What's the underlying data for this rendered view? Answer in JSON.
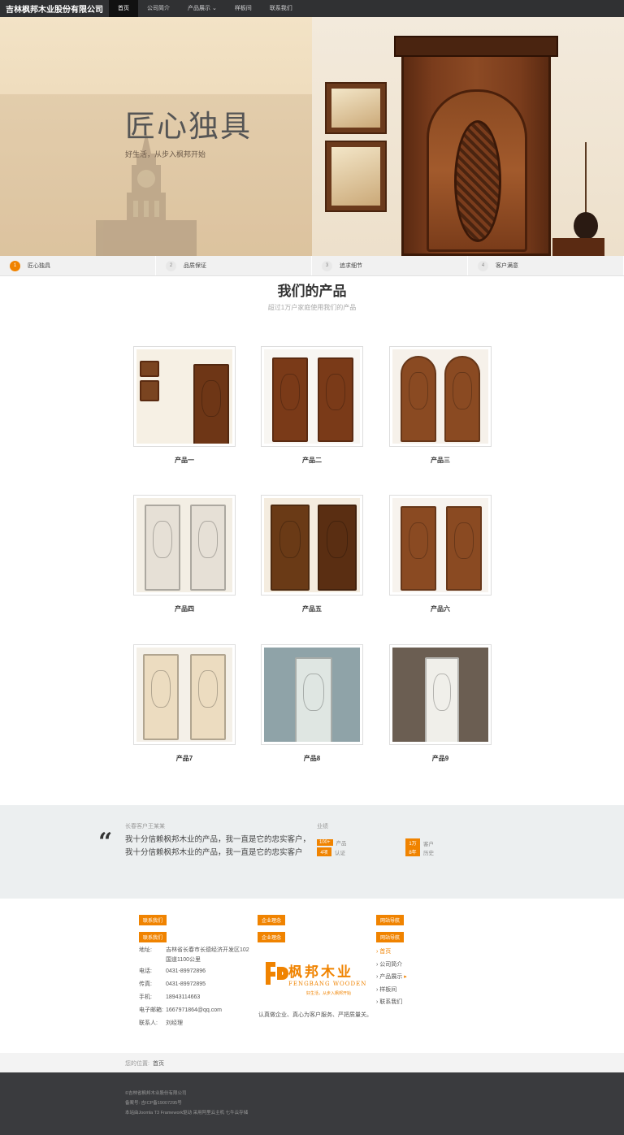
{
  "nav": {
    "brand": "吉林枫邦木业股份有限公司",
    "items": [
      {
        "label": "首页",
        "active": true
      },
      {
        "label": "公司简介"
      },
      {
        "label": "产品展示 ⌄"
      },
      {
        "label": "样板间"
      },
      {
        "label": "联系我们"
      }
    ]
  },
  "hero": {
    "title": "匠心独具",
    "subtitle": "好生活，从步入枫邦开始"
  },
  "steps": [
    {
      "num": "1",
      "label": "匠心独具"
    },
    {
      "num": "2",
      "label": "品质保证"
    },
    {
      "num": "3",
      "label": "追求细节"
    },
    {
      "num": "4",
      "label": "客户满意"
    }
  ],
  "products": {
    "title": "我们的产品",
    "subtitle": "超过1万户家庭使用我们的产品",
    "items": [
      "产品一",
      "产品二",
      "产品三",
      "产品四",
      "产品五",
      "产品六",
      "产品7",
      "产品8",
      "产品9"
    ]
  },
  "testimonial": {
    "name": "长春客户王某某",
    "text": "我十分信赖枫邦木业的产品，我一直是它的忠实客户，我十分信赖枫邦木业的产品，我一直是它的忠实客户"
  },
  "stats": {
    "label": "业绩",
    "items": [
      {
        "value": "100+",
        "label": "产品"
      },
      {
        "value": "1万",
        "label": "客户"
      },
      {
        "value": "4项",
        "label": "认证"
      },
      {
        "value": "8年",
        "label": "历史"
      }
    ]
  },
  "footer": {
    "contact_tag1": "联系我们",
    "contact_tag2": "联系我们",
    "address_key": "地址:",
    "address": "吉林省长春市长德经济开发区102国道1100公里",
    "rows": [
      {
        "k": "电话:",
        "v": "0431-89972896"
      },
      {
        "k": "传真:",
        "v": "0431-89972895"
      },
      {
        "k": "手机:",
        "v": "18943114663"
      },
      {
        "k": "电子邮箱:",
        "v": "1667971864@qq.com"
      },
      {
        "k": "联系人:",
        "v": "刘经理"
      }
    ],
    "culture_tag1": "企业理念",
    "culture_tag2": "企业理念",
    "logo_cn": "枫邦木业",
    "logo_en": "FENGBANG WOODEN",
    "logo_slogan": "好生活，从步入枫邦开始",
    "tagline": "认真做企业、真心为客户服务、严把质量关。",
    "nav_tag1": "网站导航",
    "nav_tag2": "网站导航",
    "links": [
      "首页",
      "公司简介",
      "产品展示",
      "样板间",
      "联系我们"
    ]
  },
  "breadcrumb": {
    "label": "您的位置:",
    "home": "首页"
  },
  "bottom": {
    "line1": "©吉林省枫邦木业股份有限公司",
    "line2": "备案号: 吉ICP备19007295号",
    "line3": "本站由Joomla T3 Framework驱动   采用阿里云主机 七牛云存储"
  }
}
